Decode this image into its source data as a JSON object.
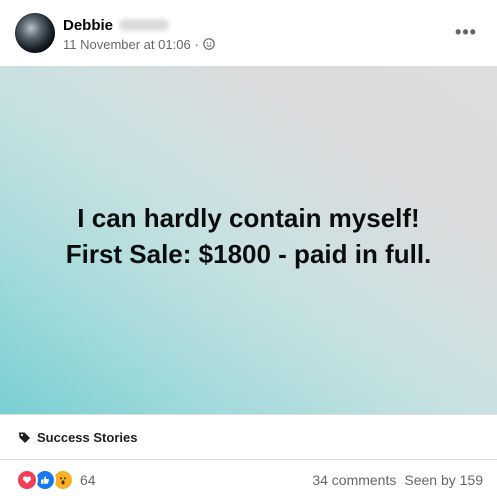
{
  "post": {
    "author": "Debbie",
    "timestamp": "11 November at 01:06",
    "separator": "·",
    "audience_icon": "friends-icon",
    "more_label": "•••",
    "image_text": {
      "line1": "I can hardly contain myself!",
      "line2": "First Sale: $1800 - paid in full."
    },
    "tag": {
      "icon": "tag-icon",
      "label": "Success Stories"
    },
    "reactions": {
      "icons": [
        "love-icon",
        "like-icon",
        "wow-icon"
      ],
      "count": "64"
    },
    "comments": "34 comments",
    "seen_by": "Seen by 159"
  },
  "colors": {
    "love": "#f33e58",
    "like": "#1877f2",
    "wow": "#f7b125",
    "gradient_teal": "#78cfd2",
    "gradient_grey": "#dddddd"
  }
}
